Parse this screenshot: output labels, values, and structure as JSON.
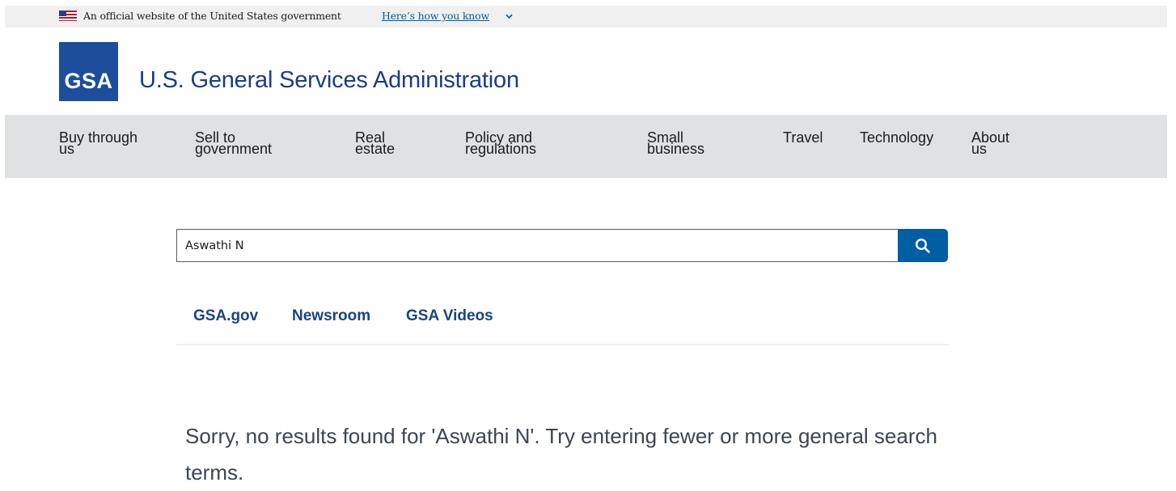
{
  "gov_banner": {
    "official_text": "An official website of the United States government",
    "how_link": "Here’s how you know",
    "flag_icon": "us-flag-icon",
    "chevron_icon": "chevron-down-icon"
  },
  "header": {
    "logo_text": "GSA",
    "title": "U.S. General Services Administration"
  },
  "nav": {
    "items": [
      {
        "line1": "Buy through",
        "line2": "us"
      },
      {
        "line1": "Sell to",
        "line2": "government"
      },
      {
        "line1": "Real",
        "line2": "estate"
      },
      {
        "line1": "Policy and",
        "line2": "regulations"
      },
      {
        "line1": "Small",
        "line2": "business"
      },
      {
        "line1": "Travel",
        "line2": ""
      },
      {
        "line1": "Technology",
        "line2": ""
      },
      {
        "line1": "About",
        "line2": "us"
      }
    ]
  },
  "search": {
    "value": "Aswathi N",
    "button_icon": "search-icon"
  },
  "tabs": [
    {
      "label": "GSA.gov"
    },
    {
      "label": "Newsroom"
    },
    {
      "label": "GSA Videos"
    }
  ],
  "results": {
    "message": "Sorry, no results found for 'Aswathi N'. Try entering fewer or more general search terms."
  },
  "colors": {
    "primary_blue": "#005ea2",
    "logo_blue": "#1c4e9b",
    "title_blue": "#1b3c89",
    "nav_bg": "#dfe1e2",
    "banner_bg": "#f0f0f0"
  }
}
